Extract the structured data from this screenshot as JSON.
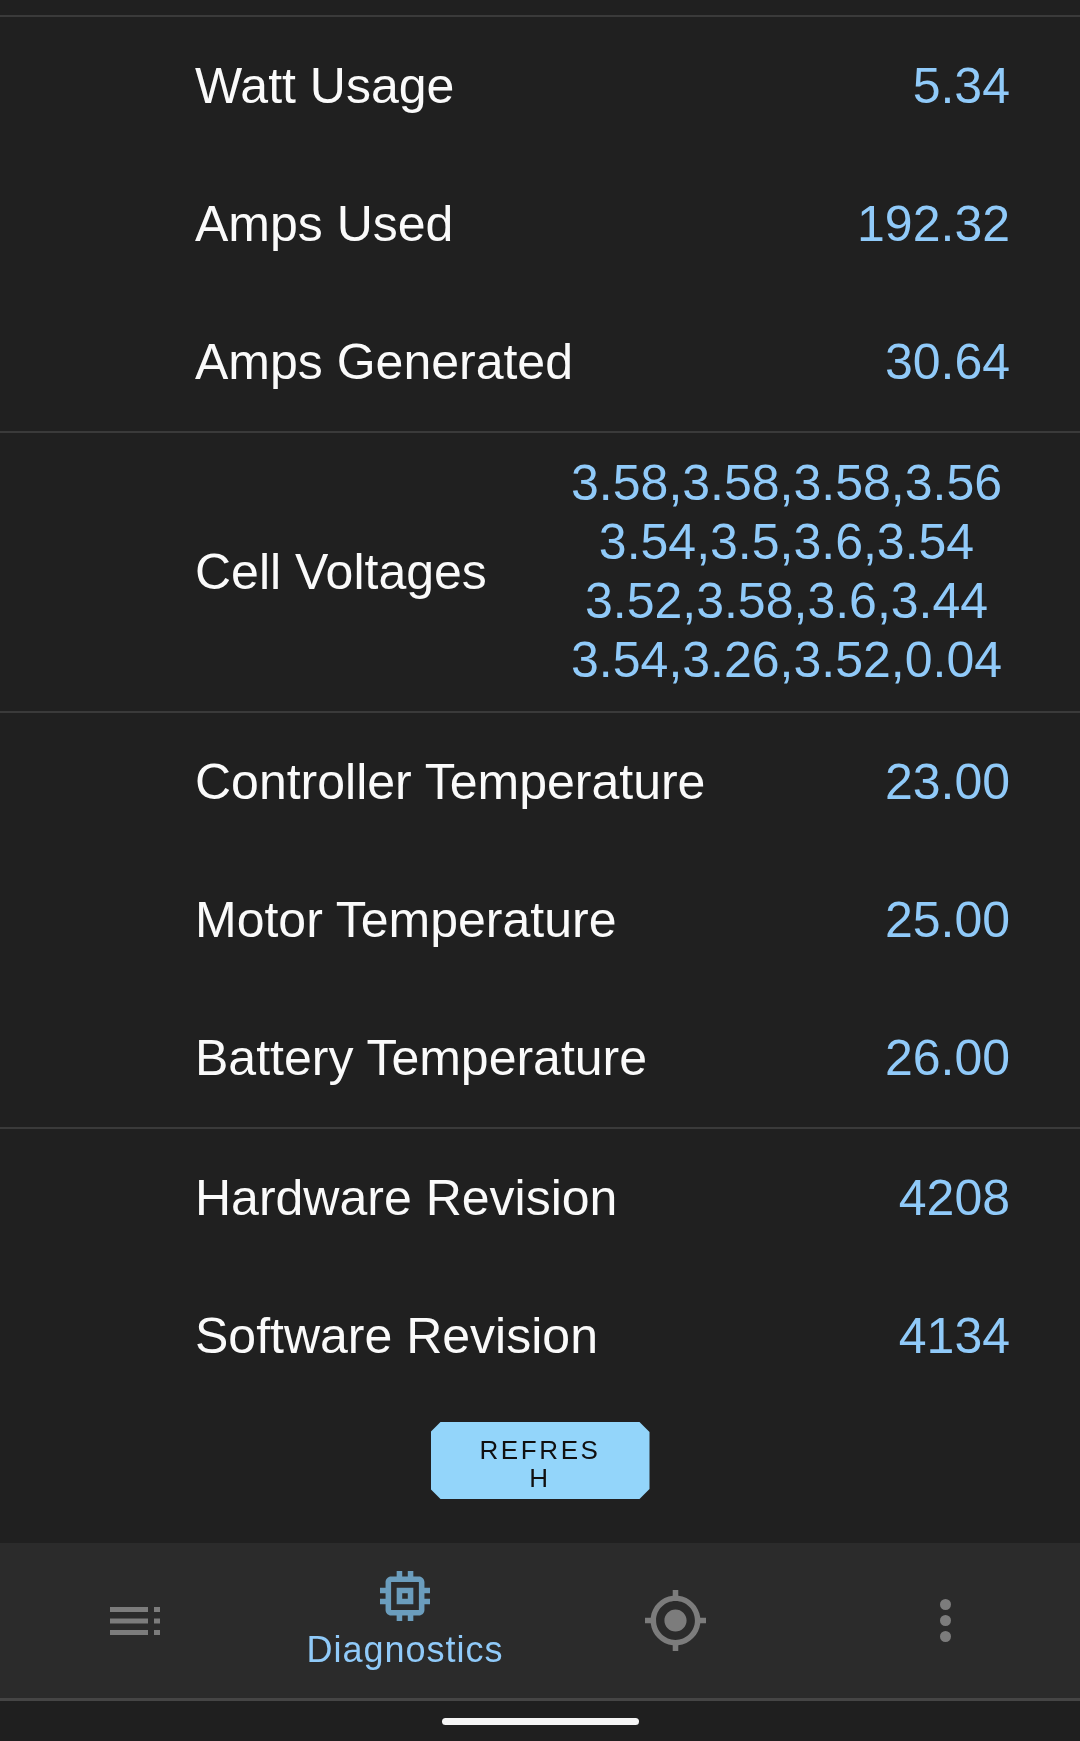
{
  "sections": [
    {
      "rows": [
        {
          "label": "Watt Usage",
          "value": "5.34"
        },
        {
          "label": "Amps Used",
          "value": "192.32"
        },
        {
          "label": "Amps Generated",
          "value": "30.64"
        }
      ]
    },
    {
      "rows": [
        {
          "label": "Cell Voltages",
          "lines": [
            "3.58,3.58,3.58,3.56",
            "3.54,3.5,3.6,3.54",
            "3.52,3.58,3.6,3.44",
            "3.54,3.26,3.52,0.04"
          ]
        }
      ]
    },
    {
      "rows": [
        {
          "label": "Controller Temperature",
          "value": "23.00"
        },
        {
          "label": "Motor Temperature",
          "value": "25.00"
        },
        {
          "label": "Battery Temperature",
          "value": "26.00"
        }
      ]
    },
    {
      "rows": [
        {
          "label": "Hardware Revision",
          "value": "4208"
        },
        {
          "label": "Software Revision",
          "value": "4134"
        }
      ]
    }
  ],
  "refresh_button": {
    "label": "REFRESH"
  },
  "bottom_nav": {
    "items": [
      {
        "kind": "list",
        "selected": false
      },
      {
        "kind": "chip",
        "label": "Diagnostics",
        "selected": true
      },
      {
        "kind": "target",
        "selected": false
      },
      {
        "kind": "more",
        "selected": false
      }
    ]
  }
}
